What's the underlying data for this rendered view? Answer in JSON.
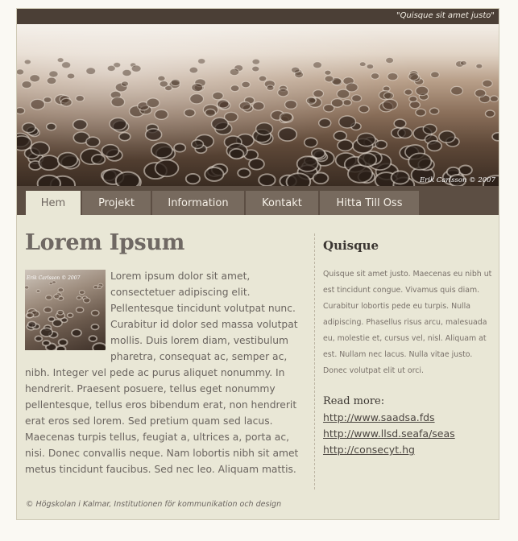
{
  "header": {
    "quote": "\"Quisque sit amet justo\"",
    "photo_credit": "Erik Carlsson © 2007"
  },
  "nav": {
    "tabs": [
      {
        "label": "Hem",
        "active": true
      },
      {
        "label": "Projekt",
        "active": false
      },
      {
        "label": "Information",
        "active": false
      },
      {
        "label": "Kontakt",
        "active": false
      },
      {
        "label": "Hitta Till Oss",
        "active": false
      }
    ]
  },
  "main": {
    "title": "Lorem Ipsum",
    "thumb_credit": "Erik Carlsson © 2007",
    "body": "Lorem ipsum dolor sit amet, consectetuer adipiscing elit. Pellentesque tincidunt volutpat nunc. Curabitur id dolor sed massa volutpat mollis. Duis lorem diam, vestibulum pharetra, consequat ac, semper ac, nibh. Integer vel pede ac purus aliquet nonummy. In hendrerit. Praesent posuere, tellus eget nonummy pellentesque, tellus eros bibendum erat, non hendrerit erat eros sed lorem. Sed pretium quam sed lacus. Maecenas turpis tellus, feugiat a, ultrices a, porta ac, nisi. Donec convallis neque. Nam lobortis nibh sit amet metus tincidunt faucibus. Sed nec leo. Aliquam mattis."
  },
  "sidebar": {
    "heading": "Quisque",
    "text": "Quisque sit amet justo. Maecenas eu nibh ut est tincidunt congue. Vivamus quis diam. Curabitur lobortis pede eu turpis. Nulla adipiscing. Phasellus risus arcu, malesuada eu, molestie et, cursus vel, nisl. Aliquam at est. Nullam nec lacus. Nulla vitae justo. Donec volutpat elit ut orci.",
    "read_more": "Read more:",
    "links": [
      "http://www.saadsa.fds",
      "http://www.llsd.seafa/seas",
      "http://consecyt.hg"
    ]
  },
  "footer": {
    "note": "© Högskolan i Kalmar, Institutionen för kommunikation och design"
  },
  "colors": {
    "header_bar": "#4b3f36",
    "nav_bar": "#5c4e43",
    "tab": "#776a5e",
    "active_tab": "#e9e7d6",
    "content_bg": "#e9e7d6",
    "page_bg": "#faf9f3"
  }
}
